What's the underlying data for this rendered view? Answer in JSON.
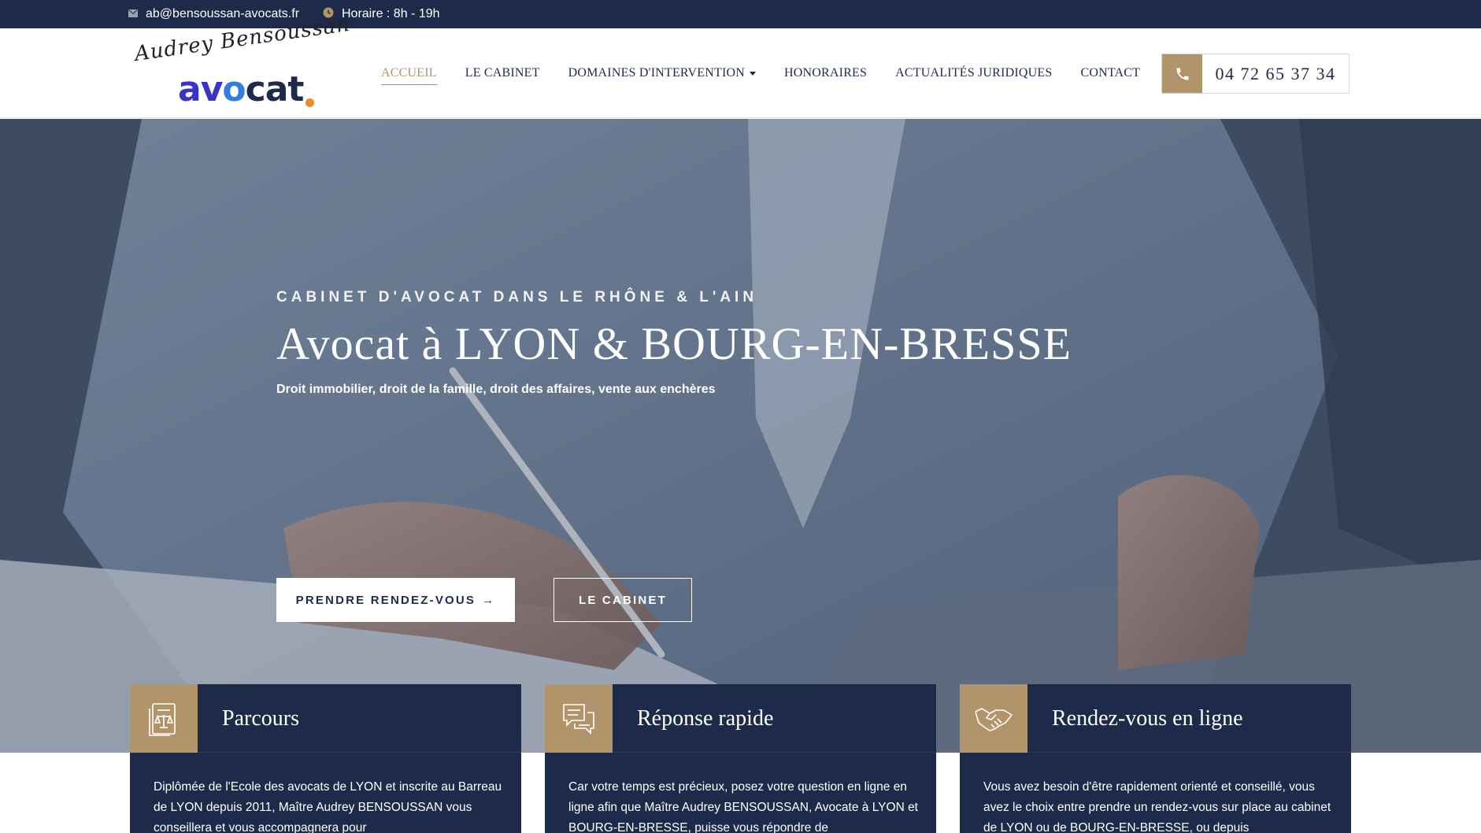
{
  "topbar": {
    "email": "ab@bensoussan-avocats.fr",
    "email_icon": "mail-icon",
    "hours": "Horaire : 8h - 19h",
    "hours_icon": "clock-icon"
  },
  "logo": {
    "signature": "Audrey Bensoussan",
    "word_part1": "av",
    "word_part2": "o",
    "word_part3": "cat"
  },
  "nav": {
    "items": [
      {
        "label": "ACCUEIL",
        "active": true
      },
      {
        "label": "LE CABINET"
      },
      {
        "label": "DOMAINES D'INTERVENTION",
        "has_dropdown": true
      },
      {
        "label": "HONORAIRES"
      },
      {
        "label": "ACTUALITÉS JURIDIQUES"
      },
      {
        "label": "CONTACT"
      }
    ]
  },
  "phone": {
    "number": "04 72 65 37 34",
    "icon": "phone-icon"
  },
  "hero": {
    "kicker": "CABINET D'AVOCAT DANS LE RHÔNE & L'AIN",
    "title": "Avocat à LYON & BOURG-EN-BRESSE",
    "subtitle": "Droit immobilier, droit de la famille, droit des affaires, vente aux enchères",
    "primary_button": "PRENDRE RENDEZ-VOUS",
    "primary_arrow": "→",
    "secondary_button": "LE CABINET"
  },
  "cards": [
    {
      "title": "Parcours",
      "icon": "document-scales-icon",
      "text": "Diplômée de l'Ecole des avocats de LYON et inscrite au Barreau de LYON depuis 2011, Maître Audrey BENSOUSSAN vous conseillera et vous accompagnera pour"
    },
    {
      "title": "Réponse rapide",
      "icon": "chat-bubbles-icon",
      "text": "Car votre temps est précieux, posez votre question en ligne en ligne afin que Maître Audrey BENSOUSSAN, Avocate à LYON et BOURG-EN-BRESSE, puisse vous répondre de"
    },
    {
      "title": "Rendez-vous en ligne",
      "icon": "handshake-icon",
      "text": "Vous avez besoin d'être rapidement orienté et conseillé, vous avez le choix entre prendre un rendez-vous sur place au cabinet de LYON ou de BOURG-EN-BRESSE, ou depuis"
    }
  ],
  "colors": {
    "navy": "#1e2a4a",
    "gold": "#b2946a",
    "white": "#ffffff",
    "logo_orange": "#f08a24"
  }
}
